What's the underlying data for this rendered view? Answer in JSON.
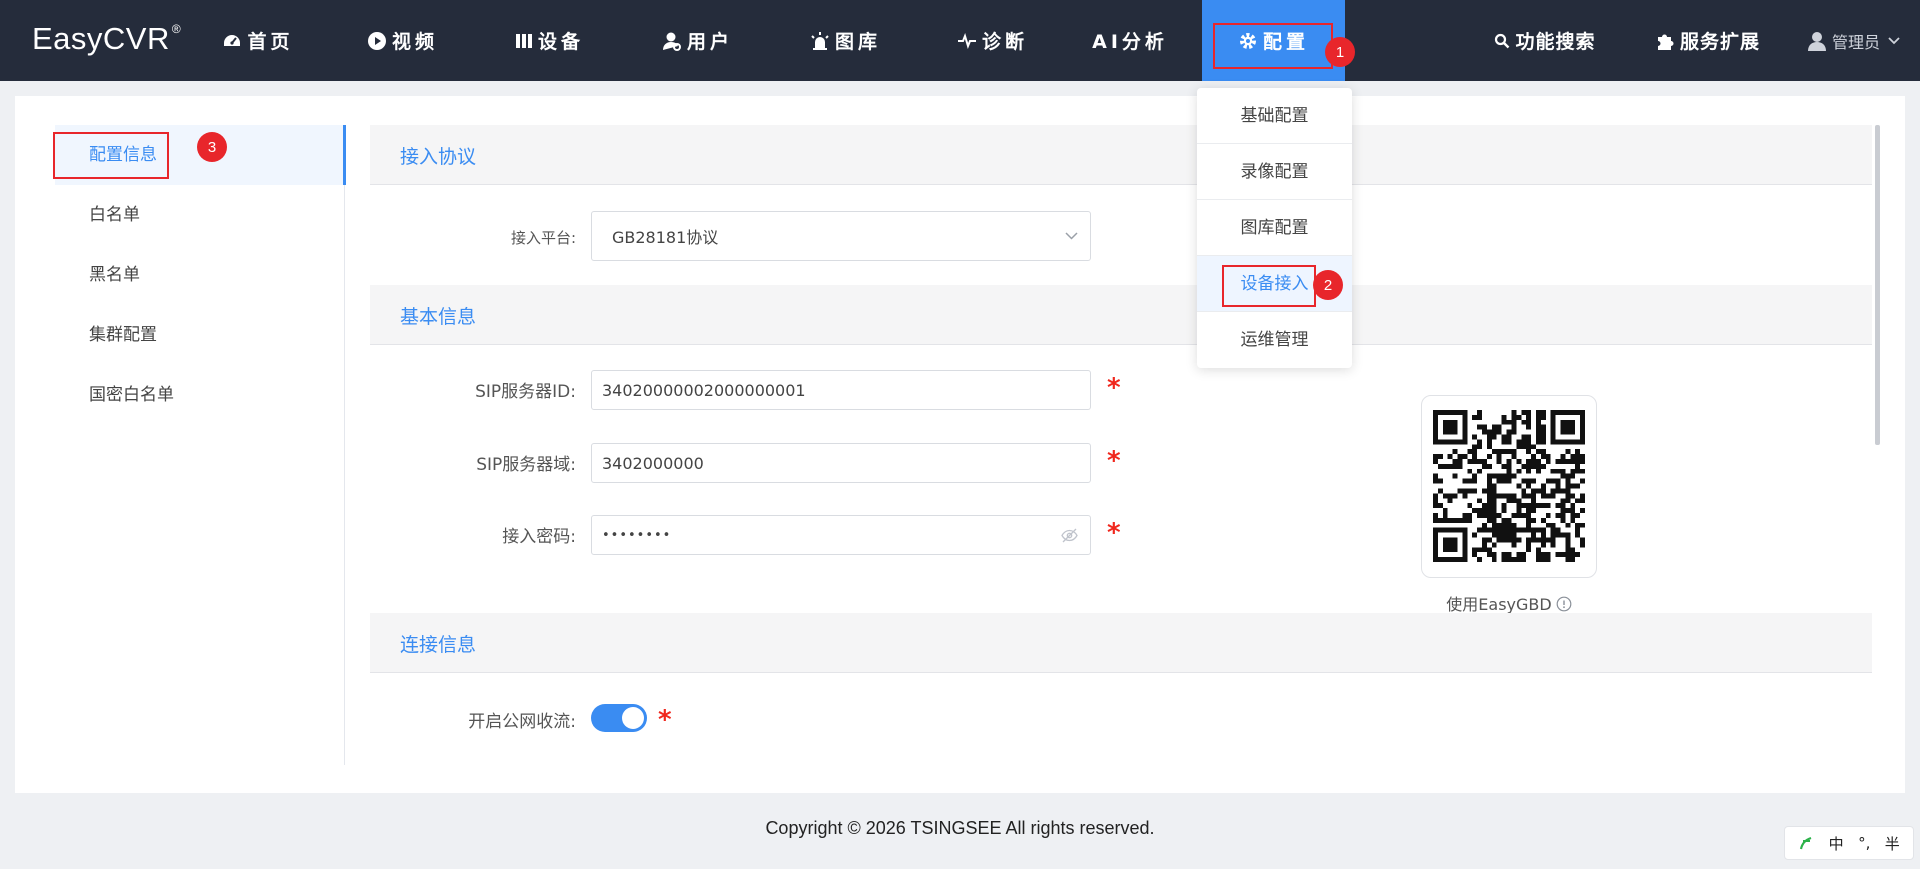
{
  "app": {
    "logo": "EasyCVR",
    "logo_mark": "®"
  },
  "nav": {
    "items": [
      {
        "label": "首页",
        "icon": "dashboard-icon"
      },
      {
        "label": "视频",
        "icon": "play-circle-icon"
      },
      {
        "label": "设备",
        "icon": "device-icon"
      },
      {
        "label": "用户",
        "icon": "user-icon"
      },
      {
        "label": "图库",
        "icon": "alarm-icon"
      },
      {
        "label": "诊断",
        "icon": "pulse-icon"
      },
      {
        "label": "AI分析",
        "icon": ""
      },
      {
        "label": "配置",
        "icon": "gear-icon",
        "active": true
      }
    ],
    "search": "功能搜索",
    "extend": "服务扩展",
    "user": "管理员"
  },
  "dropdown": {
    "items": [
      "基础配置",
      "录像配置",
      "图库配置",
      "设备接入",
      "运维管理"
    ],
    "active": "设备接入"
  },
  "sidebar": {
    "items": [
      "配置信息",
      "白名单",
      "黑名单",
      "集群配置",
      "国密白名单"
    ],
    "active": "配置信息"
  },
  "sections": {
    "protocol": {
      "title": "接入协议",
      "platform_label": "接入平台:",
      "platform_value": "GB28181协议"
    },
    "basic": {
      "title": "基本信息",
      "sip_id_label": "SIP服务器ID:",
      "sip_id_value": "34020000002000000001",
      "sip_domain_label": "SIP服务器域:",
      "sip_domain_value": "3402000000",
      "password_label": "接入密码:",
      "password_value": "••••••••",
      "qr_caption": "使用EasyGBD"
    },
    "connection": {
      "title": "连接信息",
      "public_stream_label": "开启公网收流:",
      "public_stream_on": true
    }
  },
  "annotations": [
    "1",
    "2",
    "3"
  ],
  "footer": {
    "copyright": "Copyright © 2026 TSINGSEE All rights reserved."
  },
  "ime": {
    "logo": "ime-logo-icon",
    "lang": "中",
    "punct": "°,",
    "width": "半"
  },
  "colors": {
    "topbar": "#252c3b",
    "accent": "#3a8cf2",
    "mark": "#e8262b",
    "required": "#f0271d"
  }
}
